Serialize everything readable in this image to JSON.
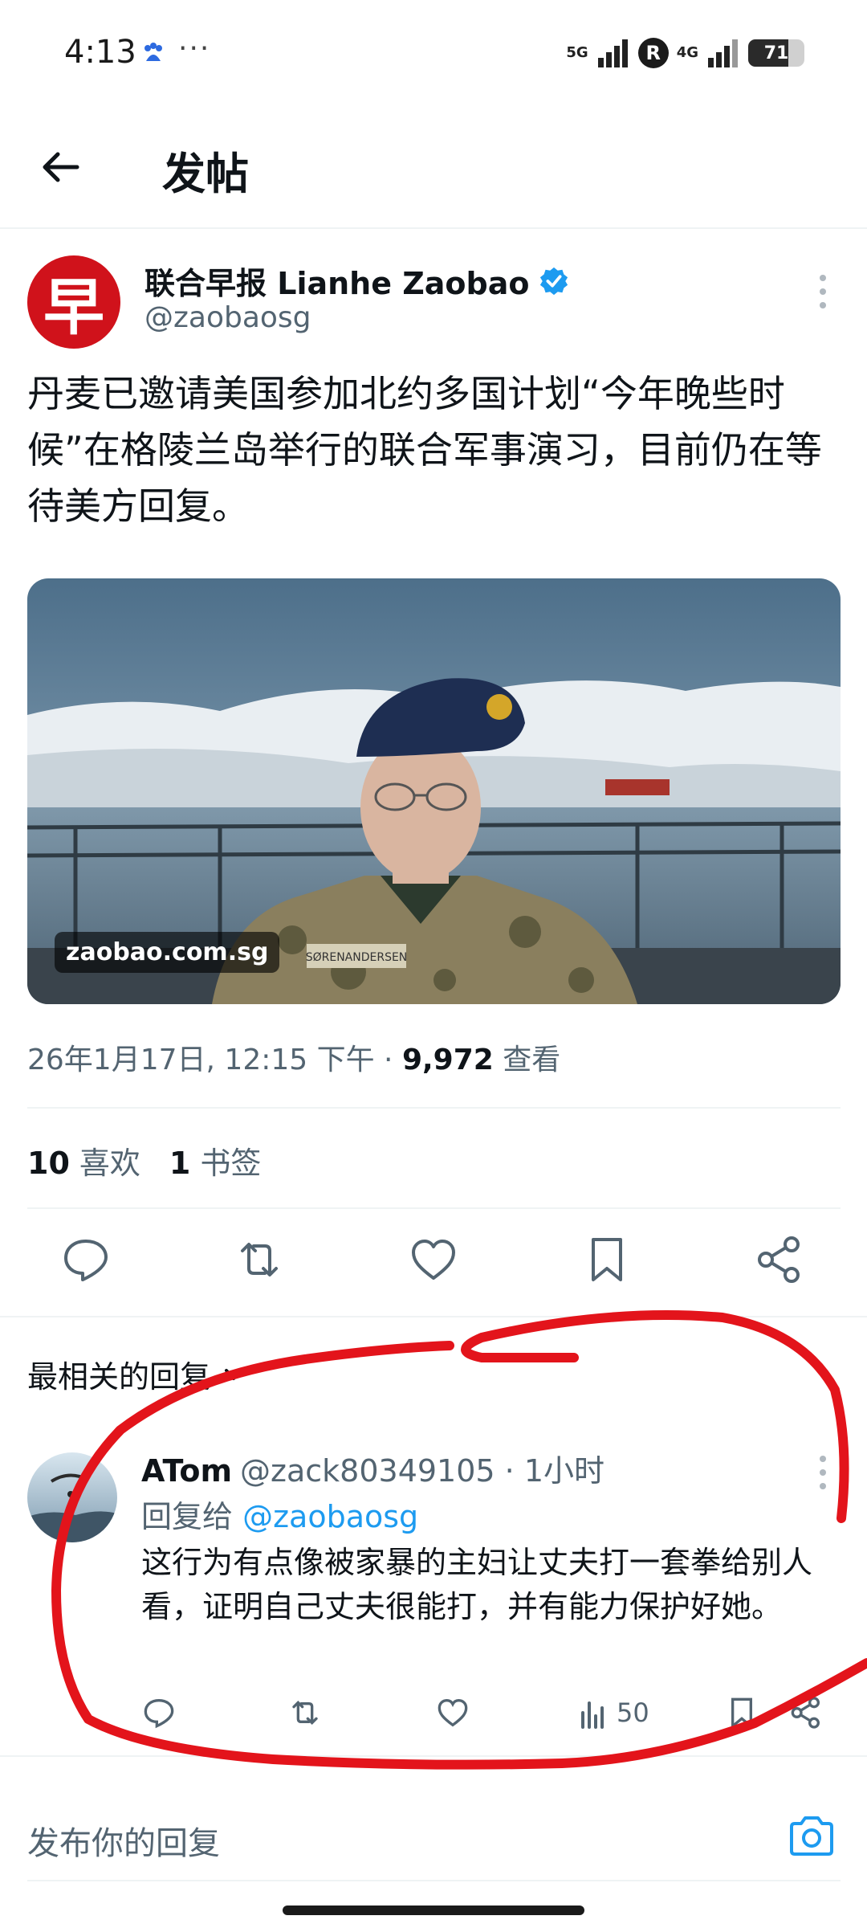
{
  "status_bar": {
    "time": "4:13",
    "dots": "···",
    "signal1_label": "5G",
    "roaming": "R",
    "signal2_label": "4G",
    "battery": "71",
    "battery_level_percent": 71
  },
  "header": {
    "title": "发帖"
  },
  "tweet": {
    "author_name": "联合早报 Lianhe Zaobao",
    "author_handle": "@zaobaosg",
    "avatar_glyph": "早",
    "text": "丹麦已邀请美国参加北约多国计划“今年晚些时候”在格陵兰岛举行的联合军事演习，目前仍在等待美方回复。",
    "image_watermark": "zaobao.com.sg",
    "image_patch_text": "SØRENANDERSEN",
    "timestamp": "26年1月17日, 12:15 下午 · ",
    "views_count": "9,972",
    "views_label": " 查看",
    "likes_count": "10",
    "likes_label": "喜欢",
    "bookmarks_count": "1",
    "bookmarks_label": "书签"
  },
  "replies_sort": "最相关的回复",
  "reply": {
    "name": "ATom",
    "handle_time": "@zack80349105 · 1小时",
    "replying_to_prefix": "回复给 ",
    "replying_to_handle": "@zaobaosg",
    "text": "这行为有点像被家暴的主妇让丈夫打一套拳给别人看，证明自己丈夫很能打，并有能力保护好她。",
    "views": "50"
  },
  "compose": {
    "placeholder": "发布你的回复"
  },
  "colors": {
    "link": "#1d9bf0",
    "verified": "#1d9bf0",
    "secondary_text": "#536471",
    "annotation_stroke": "#e3141b",
    "brand_red": "#d0121b"
  },
  "icons": [
    "baidu-icon",
    "back-arrow-icon",
    "verified-badge-icon",
    "more-vertical-icon",
    "reply-icon",
    "retweet-icon",
    "like-icon",
    "bookmark-icon",
    "share-icon",
    "chevron-down-icon",
    "views-icon",
    "camera-icon"
  ]
}
